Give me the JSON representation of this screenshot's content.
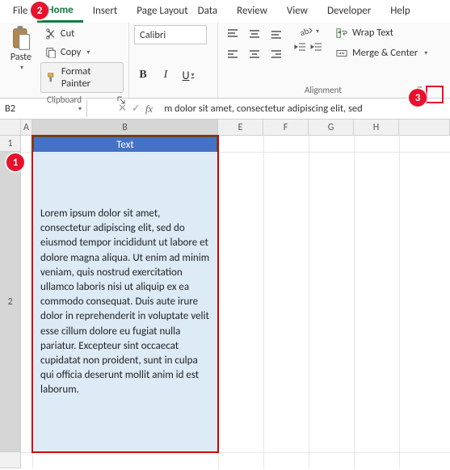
{
  "tabs": {
    "file": "File",
    "home": "Home",
    "insert": "Insert",
    "page_layout": "Page Layout",
    "data": "Data",
    "review": "Review",
    "view": "View",
    "developer": "Developer",
    "help": "Help"
  },
  "clipboard": {
    "paste": "Paste",
    "cut": "Cut",
    "copy": "Copy",
    "format_painter": "Format Painter",
    "group_label": "Clipboard"
  },
  "font": {
    "name": "Calibri",
    "bold": "B",
    "italic": "I",
    "underline": "U"
  },
  "alignment": {
    "wrap_text": "Wrap Text",
    "merge_center": "Merge & Center",
    "group_label": "Alignment"
  },
  "namebox": "B2",
  "formula_bar": "m dolor sit amet, consectetur adipiscing elit, sed",
  "columns": [
    "A",
    "B",
    "E",
    "F",
    "G",
    "H"
  ],
  "col_widths": {
    "A": 14,
    "B": 230,
    "E": 56,
    "F": 56,
    "G": 56,
    "H": 56,
    "rest": 56
  },
  "rows": {
    "r1": 20,
    "r2": 372
  },
  "cell_b1": "Text",
  "cell_b2": "Lorem ipsum dolor sit amet, consectetur adipiscing elit, sed do eiusmod tempor incididunt ut labore et dolore magna aliqua. Ut enim ad minim veniam, quis nostrud exercitation ullamco laboris nisi ut aliquip ex ea commodo consequat. Duis aute irure dolor in reprehenderit in voluptate velit esse cillum dolore eu fugiat nulla pariatur. Excepteur sint occaecat cupidatat non proident, sunt in culpa qui officia deserunt mollit anim id est laborum.",
  "callouts": {
    "c1": "1",
    "c2": "2",
    "c3": "3"
  }
}
